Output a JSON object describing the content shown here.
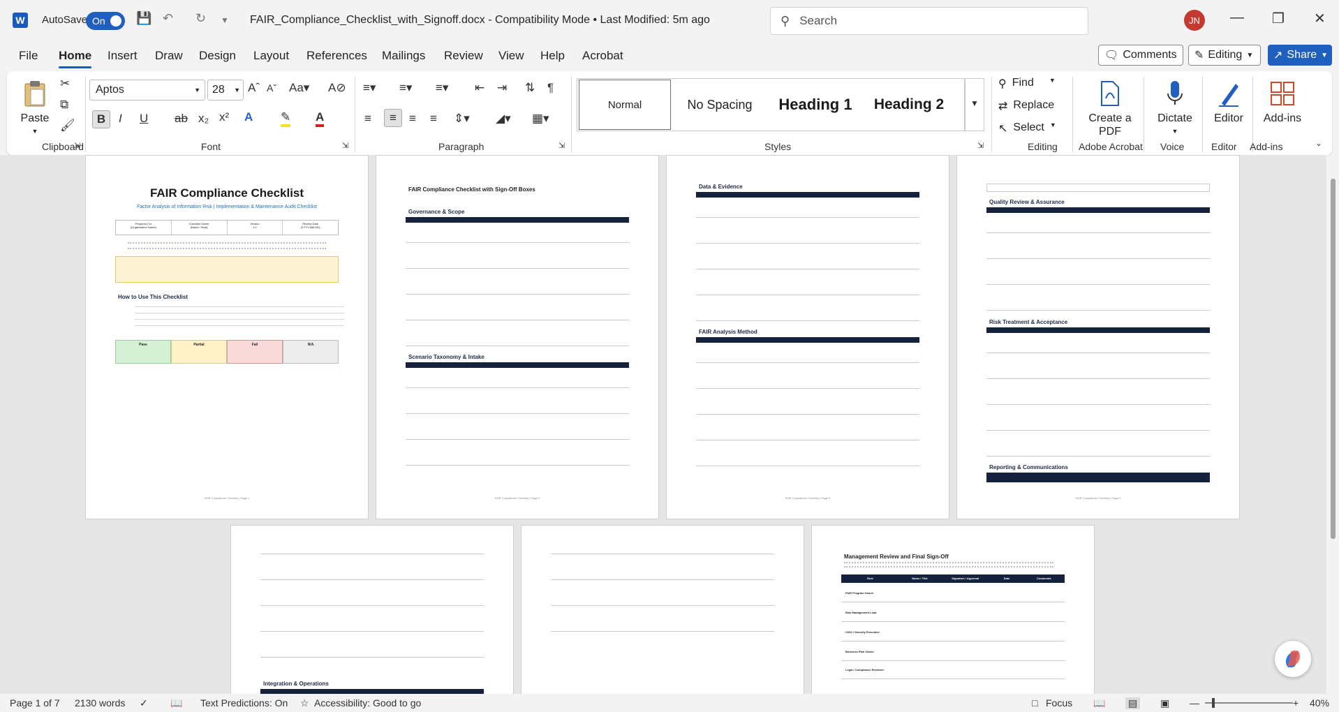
{
  "titlebar": {
    "autosave_label": "AutoSave",
    "autosave_state": "On",
    "document_title": "FAIR_Compliance_Checklist_with_Signoff.docx  -  Compatibility Mode  •  Last Modified: 5m ago",
    "search_placeholder": "Search",
    "user_initials": "JN"
  },
  "menu": {
    "file": "File",
    "home": "Home",
    "insert": "Insert",
    "draw": "Draw",
    "design": "Design",
    "layout": "Layout",
    "references": "References",
    "mailings": "Mailings",
    "review": "Review",
    "view": "View",
    "help": "Help",
    "acrobat": "Acrobat",
    "comments": "Comments",
    "editing": "Editing",
    "share": "Share"
  },
  "ribbon": {
    "paste": "Paste",
    "font_name": "Aptos",
    "font_size": "28",
    "styles": {
      "normal": "Normal",
      "no_spacing": "No Spacing",
      "heading1": "Heading 1",
      "heading2": "Heading 2"
    },
    "find": "Find",
    "replace": "Replace",
    "select": "Select",
    "create_pdf": "Create a PDF",
    "dictate": "Dictate",
    "editor": "Editor",
    "addins": "Add-ins",
    "groups": {
      "clipboard": "Clipboard",
      "font": "Font",
      "paragraph": "Paragraph",
      "styles": "Styles",
      "editing": "Editing",
      "adobe_acrobat": "Adobe Acrobat",
      "voice": "Voice",
      "editor": "Editor",
      "addins": "Add-ins"
    }
  },
  "pages": {
    "p1": {
      "title": "FAIR Compliance Checklist",
      "subtitle": "Factor Analysis of Information Risk | Implementation & Maintenance Audit Checklist",
      "meta_headers": [
        "Prepared For",
        "Checklist Owner",
        "Version",
        "Review Date"
      ],
      "meta_values": [
        "[Organization Name]",
        "[Name / Role]",
        "1.0",
        "[YYYY-MM-DD]"
      ],
      "howto": "How to Use This Checklist",
      "legend": [
        "Pass",
        "Partial",
        "Fail",
        "N/A"
      ],
      "footer": "FAIR Compliance Checklist | Page 1"
    },
    "p2": {
      "title": "FAIR Compliance Checklist with Sign-Off Boxes",
      "section1": "Governance & Scope",
      "section2": "Scenario Taxonomy & Intake",
      "footer": "FAIR Compliance Checklist | Page 2"
    },
    "p3": {
      "section1": "Data & Evidence",
      "section2": "FAIR Analysis Method",
      "footer": "FAIR Compliance Checklist | Page 3"
    },
    "p4": {
      "section1": "Quality Review & Assurance",
      "section2": "Risk Treatment & Acceptance",
      "section3": "Reporting & Communications",
      "footer": "FAIR Compliance Checklist | Page 4"
    },
    "p5": {
      "section1": "Integration & Operations"
    },
    "p7": {
      "title": "Management Review and Final Sign-Off",
      "headers": [
        "Role",
        "Name / Title",
        "Signature / Approval",
        "Date",
        "Comments"
      ],
      "roles": [
        "FAIR Program Owner",
        "Risk Management Lead",
        "CISO / Security Executive",
        "Business Risk Owner",
        "Legal / Compliance Reviewer"
      ]
    }
  },
  "status": {
    "page": "Page 1 of 7",
    "words": "2130 words",
    "text_predictions": "Text Predictions: On",
    "accessibility": "Accessibility: Good to go",
    "focus": "Focus",
    "zoom": "40%"
  }
}
